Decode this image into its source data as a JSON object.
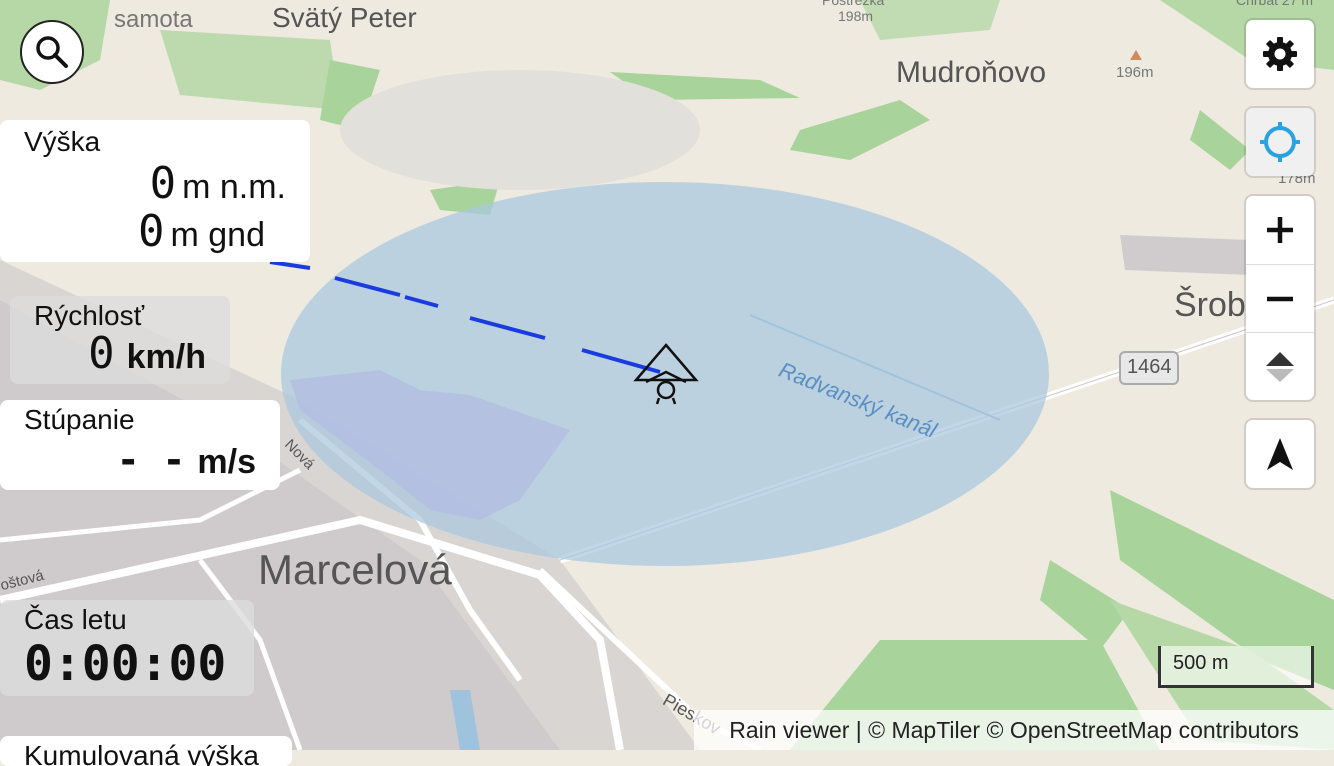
{
  "map": {
    "labels": {
      "samota": "samota",
      "svaty_peter": "Svätý Peter",
      "postrezka": "Postréžka",
      "elev_198": "198m",
      "mudronovo": "Mudroňovo",
      "elev_196": "196m",
      "chrbat": "Chrbát 27 m",
      "elev_178": "178m",
      "srob": "Šrob",
      "road_1464": "1464",
      "canal": "Radvanský kanál",
      "nova": "Nová",
      "marcelova": "Marcelová",
      "postova": "oštová",
      "pieskova": "Pieskov"
    },
    "colors": {
      "base": "#eeeae0",
      "green": "#a8d39a",
      "water_circle": "#a9c8de",
      "track": "#1a3be0",
      "urban": "#c6c2c6"
    }
  },
  "search": {
    "icon": "search-icon"
  },
  "controls": {
    "settings_icon": "gear-icon",
    "locate_icon": "crosshair-icon",
    "zoom_in_icon": "plus-icon",
    "zoom_out_icon": "minus-icon",
    "tilt_icon": "tilt-icon",
    "north_icon": "north-arrow-icon"
  },
  "panels": {
    "altitude": {
      "label": "Výška",
      "msl_value": "0",
      "msl_unit": "m n.m.",
      "gnd_value": "0",
      "gnd_unit": "m gnd"
    },
    "speed": {
      "label": "Rýchlosť",
      "value": "0",
      "unit": "km/h"
    },
    "climb": {
      "label": "Stúpanie",
      "value": "- -",
      "unit": "m/s"
    },
    "flight_time": {
      "label": "Čas letu",
      "value": "0:00:00"
    },
    "next_panel_label": "Kumulovaná výška"
  },
  "scale_bar": {
    "label": "500 m"
  },
  "attribution": {
    "text": "Rain viewer | © MapTiler © OpenStreetMap contributors"
  }
}
